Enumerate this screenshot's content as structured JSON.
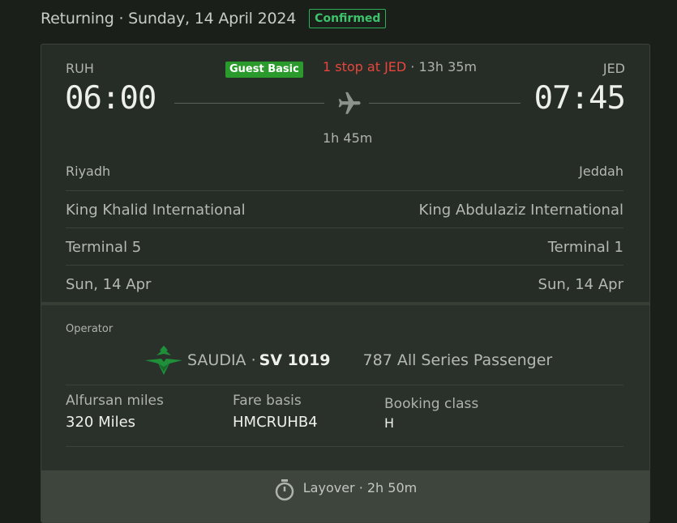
{
  "header": {
    "title": "Returning · Sunday, 14 April 2024",
    "status": "Confirmed"
  },
  "flight": {
    "origin_code": "RUH",
    "destination_code": "JED",
    "departure_time": "06:00",
    "arrival_time": "07:45",
    "fare_badge": "Guest Basic",
    "stops": "1 stop at JED",
    "separator": " · ",
    "total_duration": "13h 35m",
    "segment_duration": "1h 45m",
    "origin_city": "Riyadh",
    "destination_city": "Jeddah",
    "origin_airport": "King Khalid International",
    "destination_airport": "King Abdulaziz International",
    "origin_terminal": "Terminal 5",
    "destination_terminal": "Terminal 1",
    "departure_date": "Sun, 14 Apr",
    "arrival_date": "Sun, 14 Apr"
  },
  "operator": {
    "label": "Operator",
    "airline": "SAUDIA ·",
    "flight_number": "SV 1019",
    "aircraft": "787 All Series Passenger",
    "logo_icon": "saudia-palm-logo"
  },
  "details": {
    "miles_label": "Alfursan miles",
    "miles_value": "320 Miles",
    "fare_basis_label": "Fare basis",
    "fare_basis_value": "HMCRUHB4",
    "booking_class_label": "Booking class",
    "booking_class_value": "H"
  },
  "layover": {
    "text": "Layover · 2h 50m",
    "icon": "stopwatch-icon"
  },
  "colors": {
    "confirmed": "#3cc36b",
    "stops": "#e8463c",
    "fare_badge": "#2b9a2c",
    "logo": "#1f8f3a"
  }
}
